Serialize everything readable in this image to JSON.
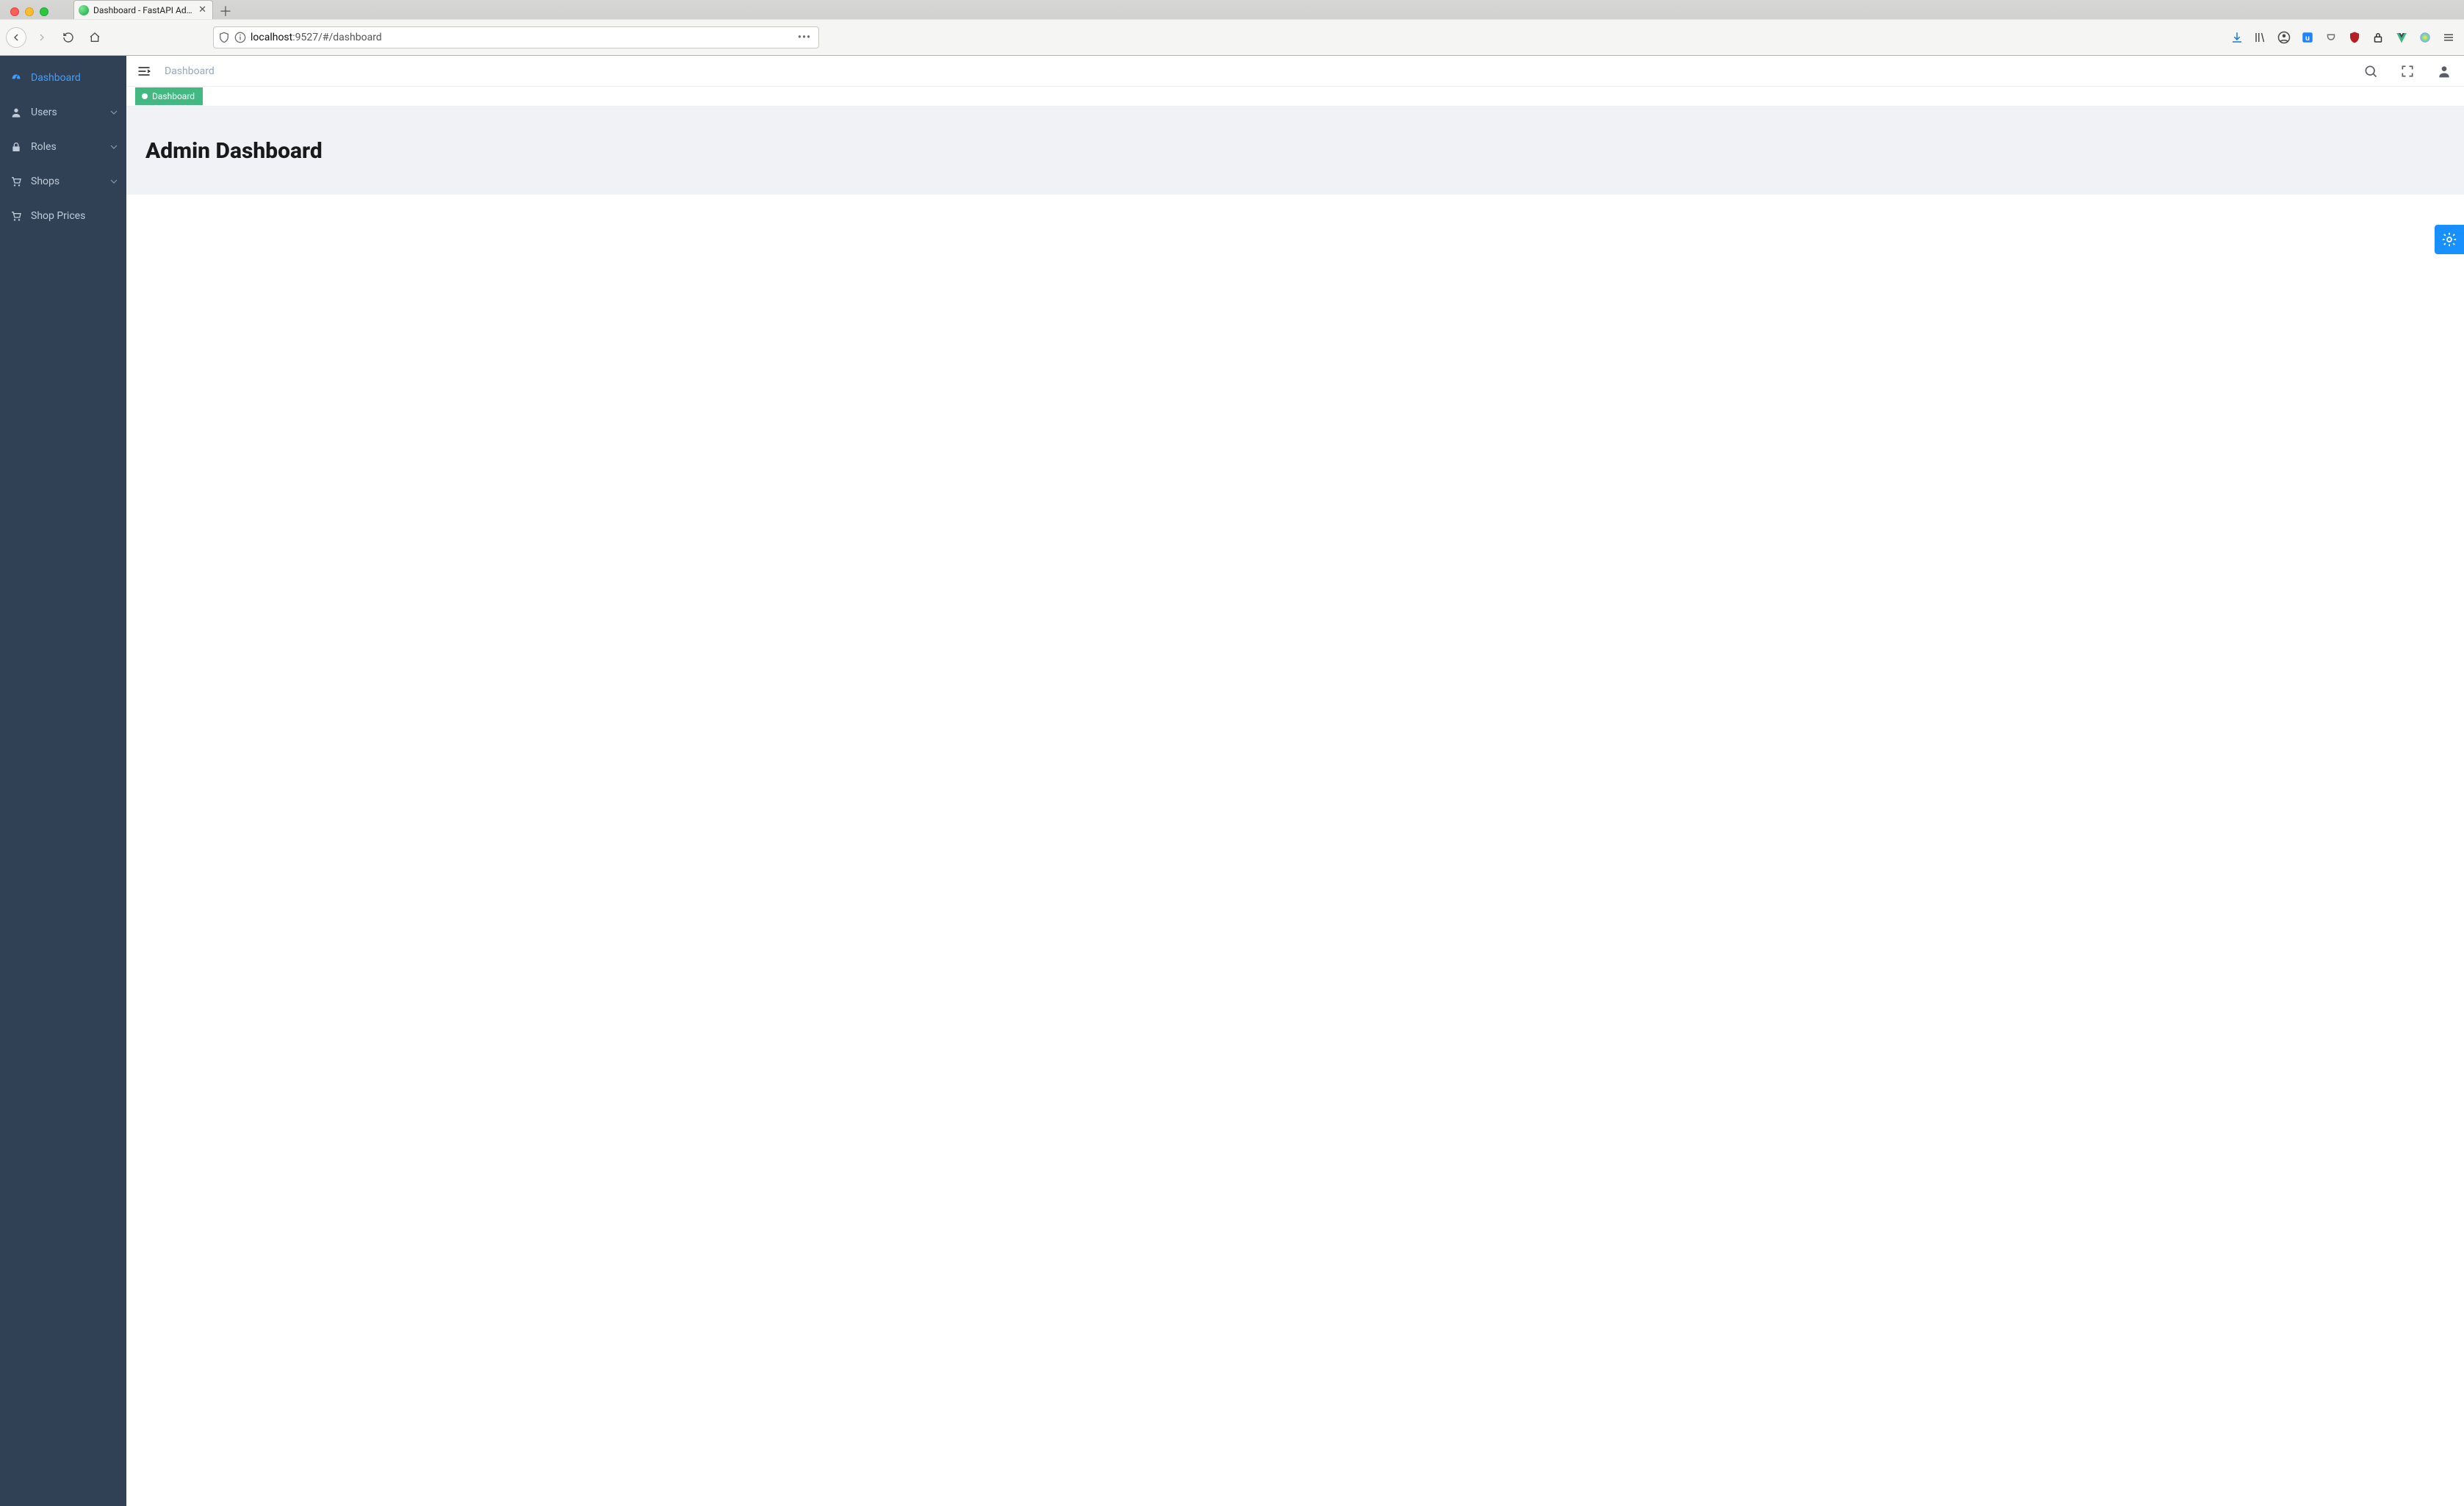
{
  "browser": {
    "tab_title": "Dashboard - FastAPI Admin Tem",
    "url_host": "localhost",
    "url_port_path": ":9527/#/dashboard"
  },
  "sidebar": {
    "items": [
      {
        "label": "Dashboard",
        "icon": "dashboard-icon",
        "active": true,
        "expandable": false
      },
      {
        "label": "Users",
        "icon": "user-icon",
        "active": false,
        "expandable": true
      },
      {
        "label": "Roles",
        "icon": "lock-icon",
        "active": false,
        "expandable": true
      },
      {
        "label": "Shops",
        "icon": "cart-icon",
        "active": false,
        "expandable": true
      },
      {
        "label": "Shop Prices",
        "icon": "cart-icon",
        "active": false,
        "expandable": false
      }
    ]
  },
  "topbar": {
    "breadcrumb": "Dashboard"
  },
  "tags": {
    "active_tag": "Dashboard"
  },
  "content": {
    "heading": "Admin Dashboard"
  }
}
